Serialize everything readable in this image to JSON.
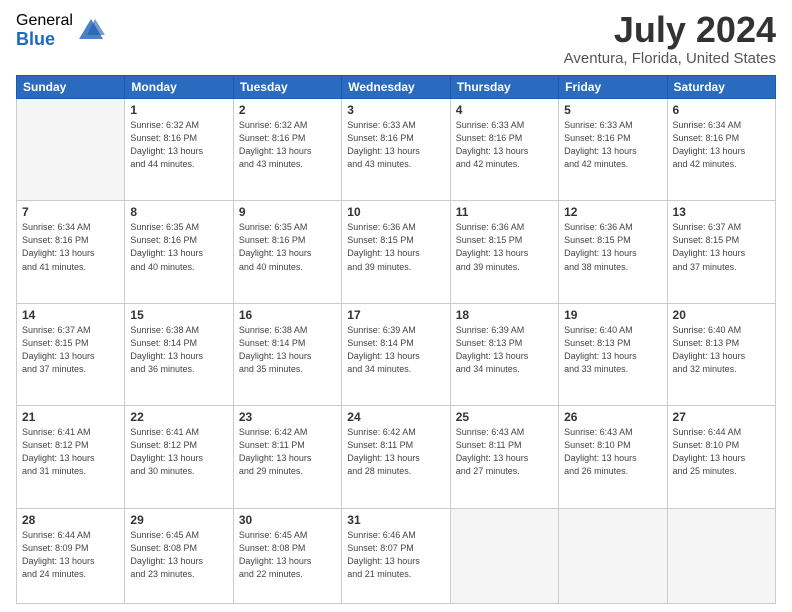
{
  "logo": {
    "general": "General",
    "blue": "Blue"
  },
  "title": "July 2024",
  "subtitle": "Aventura, Florida, United States",
  "days_of_week": [
    "Sunday",
    "Monday",
    "Tuesday",
    "Wednesday",
    "Thursday",
    "Friday",
    "Saturday"
  ],
  "weeks": [
    [
      {
        "day": "",
        "info": ""
      },
      {
        "day": "1",
        "info": "Sunrise: 6:32 AM\nSunset: 8:16 PM\nDaylight: 13 hours\nand 44 minutes."
      },
      {
        "day": "2",
        "info": "Sunrise: 6:32 AM\nSunset: 8:16 PM\nDaylight: 13 hours\nand 43 minutes."
      },
      {
        "day": "3",
        "info": "Sunrise: 6:33 AM\nSunset: 8:16 PM\nDaylight: 13 hours\nand 43 minutes."
      },
      {
        "day": "4",
        "info": "Sunrise: 6:33 AM\nSunset: 8:16 PM\nDaylight: 13 hours\nand 42 minutes."
      },
      {
        "day": "5",
        "info": "Sunrise: 6:33 AM\nSunset: 8:16 PM\nDaylight: 13 hours\nand 42 minutes."
      },
      {
        "day": "6",
        "info": "Sunrise: 6:34 AM\nSunset: 8:16 PM\nDaylight: 13 hours\nand 42 minutes."
      }
    ],
    [
      {
        "day": "7",
        "info": "Sunrise: 6:34 AM\nSunset: 8:16 PM\nDaylight: 13 hours\nand 41 minutes."
      },
      {
        "day": "8",
        "info": "Sunrise: 6:35 AM\nSunset: 8:16 PM\nDaylight: 13 hours\nand 40 minutes."
      },
      {
        "day": "9",
        "info": "Sunrise: 6:35 AM\nSunset: 8:16 PM\nDaylight: 13 hours\nand 40 minutes."
      },
      {
        "day": "10",
        "info": "Sunrise: 6:36 AM\nSunset: 8:15 PM\nDaylight: 13 hours\nand 39 minutes."
      },
      {
        "day": "11",
        "info": "Sunrise: 6:36 AM\nSunset: 8:15 PM\nDaylight: 13 hours\nand 39 minutes."
      },
      {
        "day": "12",
        "info": "Sunrise: 6:36 AM\nSunset: 8:15 PM\nDaylight: 13 hours\nand 38 minutes."
      },
      {
        "day": "13",
        "info": "Sunrise: 6:37 AM\nSunset: 8:15 PM\nDaylight: 13 hours\nand 37 minutes."
      }
    ],
    [
      {
        "day": "14",
        "info": "Sunrise: 6:37 AM\nSunset: 8:15 PM\nDaylight: 13 hours\nand 37 minutes."
      },
      {
        "day": "15",
        "info": "Sunrise: 6:38 AM\nSunset: 8:14 PM\nDaylight: 13 hours\nand 36 minutes."
      },
      {
        "day": "16",
        "info": "Sunrise: 6:38 AM\nSunset: 8:14 PM\nDaylight: 13 hours\nand 35 minutes."
      },
      {
        "day": "17",
        "info": "Sunrise: 6:39 AM\nSunset: 8:14 PM\nDaylight: 13 hours\nand 34 minutes."
      },
      {
        "day": "18",
        "info": "Sunrise: 6:39 AM\nSunset: 8:13 PM\nDaylight: 13 hours\nand 34 minutes."
      },
      {
        "day": "19",
        "info": "Sunrise: 6:40 AM\nSunset: 8:13 PM\nDaylight: 13 hours\nand 33 minutes."
      },
      {
        "day": "20",
        "info": "Sunrise: 6:40 AM\nSunset: 8:13 PM\nDaylight: 13 hours\nand 32 minutes."
      }
    ],
    [
      {
        "day": "21",
        "info": "Sunrise: 6:41 AM\nSunset: 8:12 PM\nDaylight: 13 hours\nand 31 minutes."
      },
      {
        "day": "22",
        "info": "Sunrise: 6:41 AM\nSunset: 8:12 PM\nDaylight: 13 hours\nand 30 minutes."
      },
      {
        "day": "23",
        "info": "Sunrise: 6:42 AM\nSunset: 8:11 PM\nDaylight: 13 hours\nand 29 minutes."
      },
      {
        "day": "24",
        "info": "Sunrise: 6:42 AM\nSunset: 8:11 PM\nDaylight: 13 hours\nand 28 minutes."
      },
      {
        "day": "25",
        "info": "Sunrise: 6:43 AM\nSunset: 8:11 PM\nDaylight: 13 hours\nand 27 minutes."
      },
      {
        "day": "26",
        "info": "Sunrise: 6:43 AM\nSunset: 8:10 PM\nDaylight: 13 hours\nand 26 minutes."
      },
      {
        "day": "27",
        "info": "Sunrise: 6:44 AM\nSunset: 8:10 PM\nDaylight: 13 hours\nand 25 minutes."
      }
    ],
    [
      {
        "day": "28",
        "info": "Sunrise: 6:44 AM\nSunset: 8:09 PM\nDaylight: 13 hours\nand 24 minutes."
      },
      {
        "day": "29",
        "info": "Sunrise: 6:45 AM\nSunset: 8:08 PM\nDaylight: 13 hours\nand 23 minutes."
      },
      {
        "day": "30",
        "info": "Sunrise: 6:45 AM\nSunset: 8:08 PM\nDaylight: 13 hours\nand 22 minutes."
      },
      {
        "day": "31",
        "info": "Sunrise: 6:46 AM\nSunset: 8:07 PM\nDaylight: 13 hours\nand 21 minutes."
      },
      {
        "day": "",
        "info": ""
      },
      {
        "day": "",
        "info": ""
      },
      {
        "day": "",
        "info": ""
      }
    ]
  ]
}
